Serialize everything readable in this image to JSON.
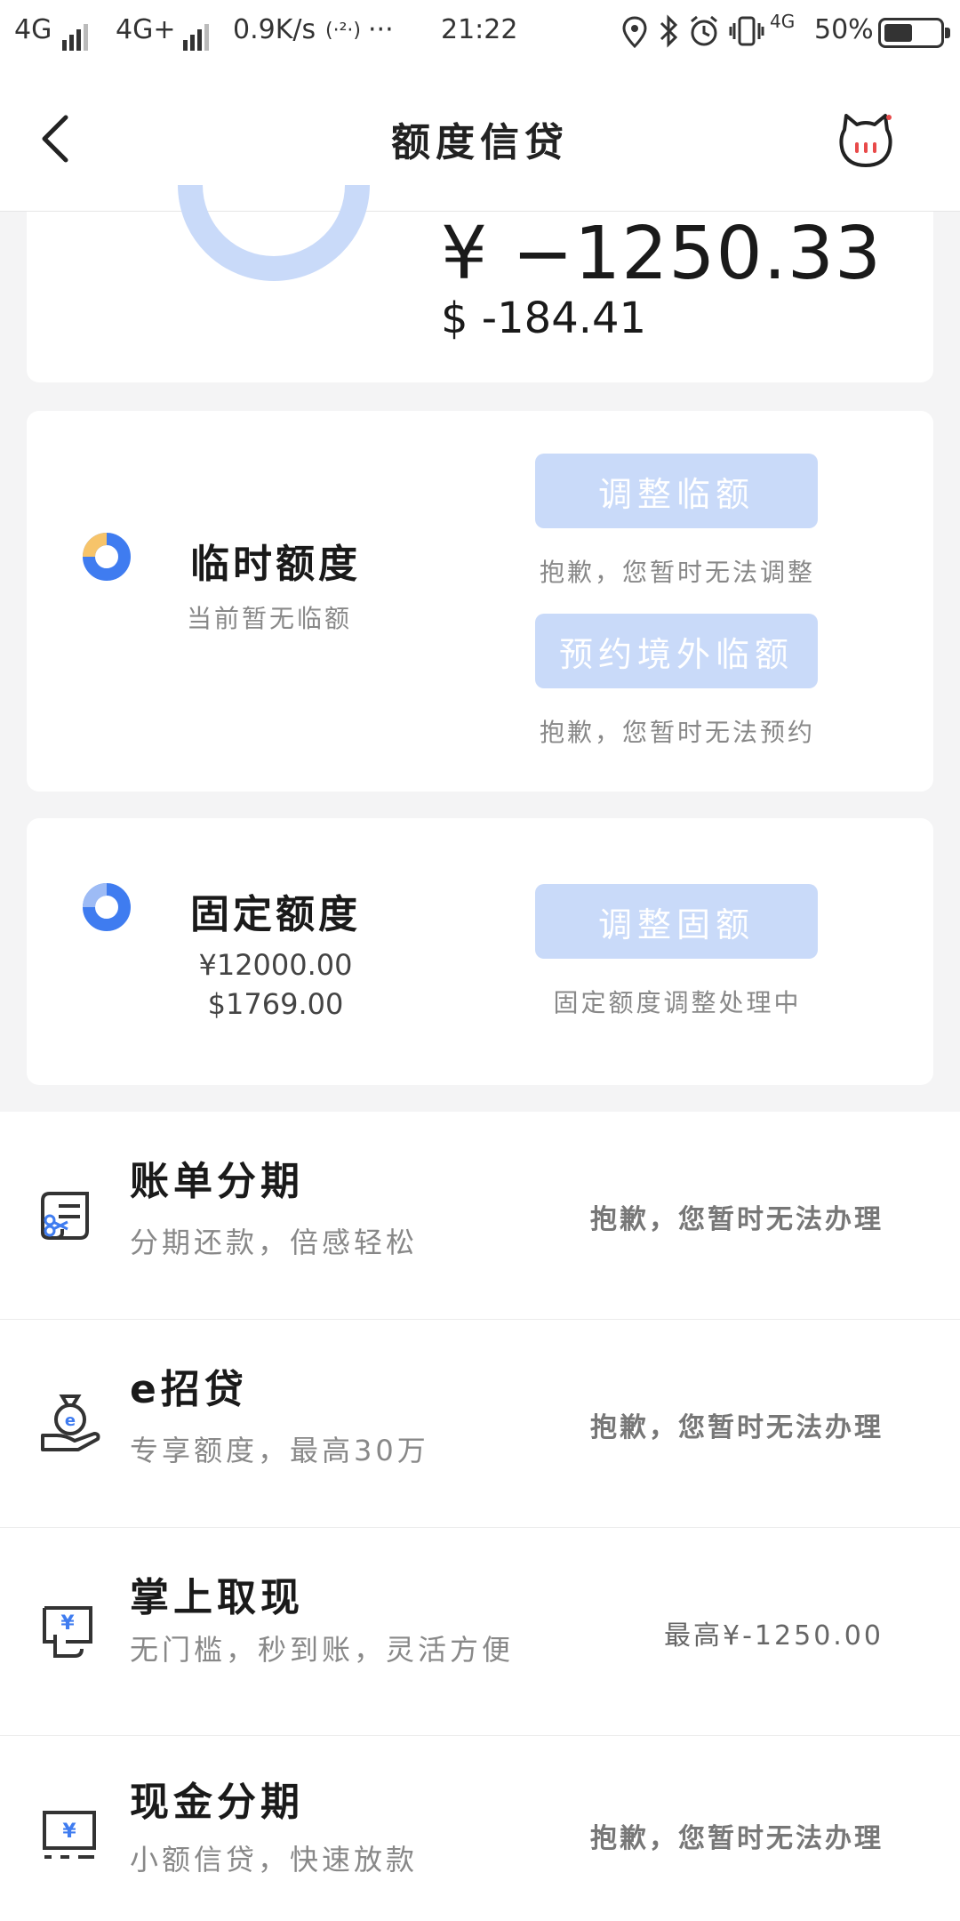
{
  "status_bar": {
    "network1": "4G",
    "network2": "4G+",
    "speed": "0.9K/s",
    "hotspot": "(·²·)",
    "dots": "···",
    "time": "21:22",
    "lte": "4G",
    "battery": "50%",
    "battery_level": 0.5
  },
  "nav": {
    "title": "额度信贷"
  },
  "balance": {
    "cny": "¥ −1250.33",
    "usd": "$ -184.41"
  },
  "temp_limit": {
    "title": "临时额度",
    "subtitle": "当前暂无临额",
    "adjust_button": "调整临额",
    "adjust_note": "抱歉，您暂时无法调整",
    "reserve_button": "预约境外临额",
    "reserve_note": "抱歉，您暂时无法预约"
  },
  "fixed_limit": {
    "title": "固定额度",
    "cny": "¥12000.00",
    "usd": "$1769.00",
    "adjust_button": "调整固额",
    "adjust_note": "固定额度调整处理中"
  },
  "services": [
    {
      "title": "账单分期",
      "subtitle": "分期还款，倍感轻松",
      "status": "抱歉，您暂时无法办理"
    },
    {
      "title": "e招贷",
      "subtitle": "专享额度，最高30万",
      "status": "抱歉，您暂时无法办理"
    },
    {
      "title": "掌上取现",
      "subtitle": "无门槛，秒到账，灵活方便",
      "status": "最高¥-1250.00"
    },
    {
      "title": "现金分期",
      "subtitle": "小额信贷，快速放款",
      "status": "抱歉，您暂时无法办理"
    }
  ],
  "colors": {
    "accent_blue": "#c9daf9",
    "icon_blue": "#3f7cf0",
    "icon_orange": "#f7c46a",
    "text_dark": "#1a1a1a",
    "text_gray": "#888888"
  }
}
